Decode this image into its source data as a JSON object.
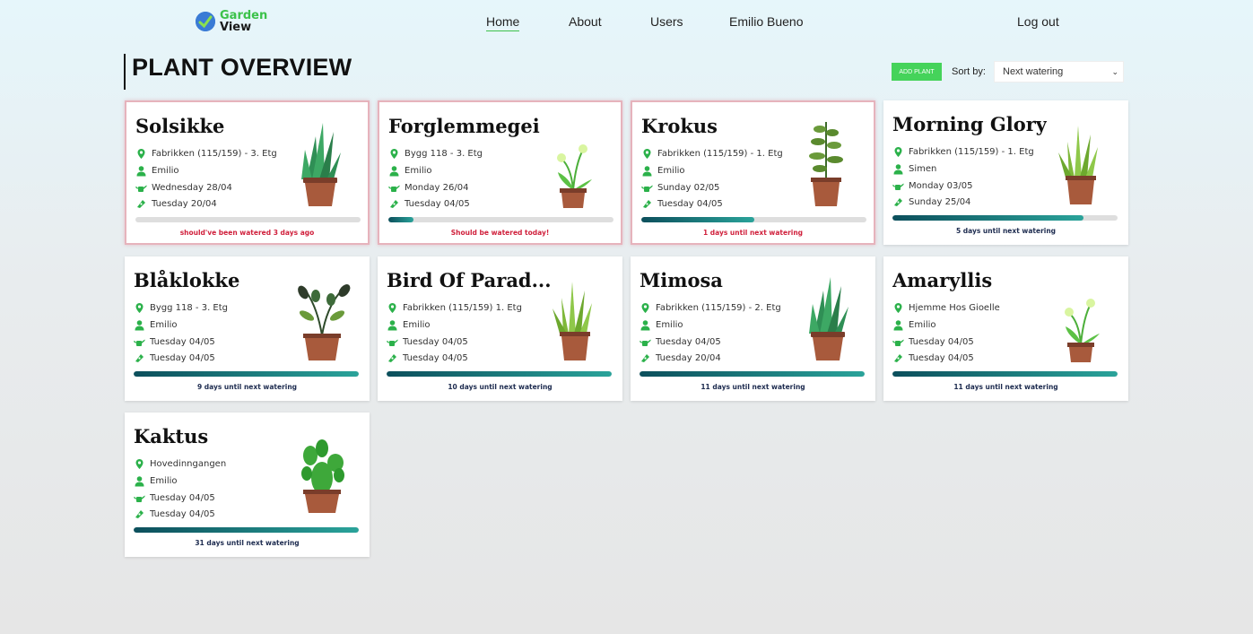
{
  "header": {
    "logo_line1": "Garden",
    "logo_line2": "View",
    "nav": [
      "Home",
      "About",
      "Users",
      "Emilio Bueno"
    ],
    "logout": "Log out"
  },
  "page": {
    "title": "PLANT OVERVIEW",
    "add_button": "ADD PLANT",
    "sort_label": "Sort by:",
    "sort_value": "Next watering"
  },
  "colors": {
    "accent_green": "#45d35a",
    "alert_red": "#d0203c",
    "progress_start": "#0c4f5c",
    "progress_end": "#2aa39a"
  },
  "cards": [
    {
      "name": "Solsikke",
      "location": "Fabrikken (115/159) - 3. Etg",
      "owner": "Emilio",
      "next_watering": "Wednesday 28/04",
      "last_watered": "Tuesday 20/04",
      "progress": 0.0,
      "status": "should've been watered 3 days ago",
      "alert": true,
      "plant_icon": "aloe-plant-icon"
    },
    {
      "name": "Forglemmegei",
      "location": "Bygg 118 - 3. Etg",
      "owner": "Emilio",
      "next_watering": "Monday 26/04",
      "last_watered": "Tuesday 04/05",
      "progress": 0.11,
      "status": "Should be watered today!",
      "alert": true,
      "plant_icon": "flower-plant-icon"
    },
    {
      "name": "Krokus",
      "location": "Fabrikken (115/159) - 1. Etg",
      "owner": "Emilio",
      "next_watering": "Sunday 02/05",
      "last_watered": "Tuesday 04/05",
      "progress": 0.5,
      "status": "1 days until next watering",
      "alert": true,
      "plant_icon": "leafy-plant-icon"
    },
    {
      "name": "Morning Glory",
      "location": "Fabrikken (115/159) - 1. Etg",
      "owner": "Simen",
      "next_watering": "Monday 03/05",
      "last_watered": "Sunday 25/04",
      "progress": 0.85,
      "status": "5 days until next watering",
      "alert": false,
      "plant_icon": "grass-plant-icon"
    },
    {
      "name": "Blåklokke",
      "location": "Bygg 118 - 3. Etg",
      "owner": "Emilio",
      "next_watering": "Tuesday 04/05",
      "last_watered": "Tuesday 04/05",
      "progress": 1.0,
      "status": "9 days until next watering",
      "alert": false,
      "plant_icon": "broadleaf-plant-icon"
    },
    {
      "name": "Bird Of Parad...",
      "location": "Fabrikken (115/159) 1. Etg",
      "owner": "Emilio",
      "next_watering": "Tuesday 04/05",
      "last_watered": "Tuesday 04/05",
      "progress": 1.0,
      "status": "10 days until next watering",
      "alert": false,
      "plant_icon": "grass-plant-icon"
    },
    {
      "name": "Mimosa",
      "location": "Fabrikken (115/159) - 2. Etg",
      "owner": "Emilio",
      "next_watering": "Tuesday 04/05",
      "last_watered": "Tuesday 20/04",
      "progress": 1.0,
      "status": "11 days until next watering",
      "alert": false,
      "plant_icon": "aloe-plant-icon"
    },
    {
      "name": "Amaryllis",
      "location": "Hjemme Hos Gioelle",
      "owner": "Emilio",
      "next_watering": "Tuesday 04/05",
      "last_watered": "Tuesday 04/05",
      "progress": 1.0,
      "status": "11 days until next watering",
      "alert": false,
      "plant_icon": "flower-plant-icon"
    },
    {
      "name": "Kaktus",
      "location": "Hovedinngangen",
      "owner": "Emilio",
      "next_watering": "Tuesday 04/05",
      "last_watered": "Tuesday 04/05",
      "progress": 1.0,
      "status": "31 days until next watering",
      "alert": false,
      "plant_icon": "cactus-plant-icon"
    }
  ]
}
